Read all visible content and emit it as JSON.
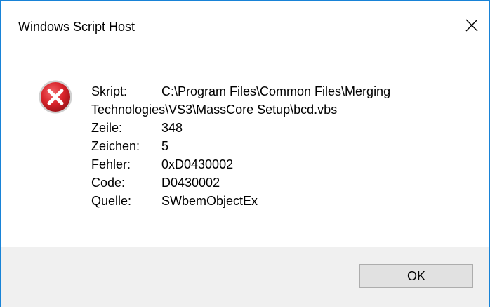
{
  "window": {
    "title": "Windows Script Host",
    "close_icon": "close-icon"
  },
  "message": {
    "icon": "error-icon",
    "script_label": "Skript:",
    "script_value_line1": "C:\\Program Files\\Common Files\\Merging",
    "script_value_line2": "Technologies\\VS3\\MassCore Setup\\bcd.vbs",
    "line_label": "Zeile:",
    "line_value": "348",
    "char_label": "Zeichen:",
    "char_value": "5",
    "error_label": "Fehler:",
    "error_value": "0xD0430002",
    "code_label": "Code:",
    "code_value": "D0430002",
    "source_label": "Quelle:",
    "source_value": "SWbemObjectEx"
  },
  "buttons": {
    "ok_label": "OK"
  },
  "colors": {
    "window_border": "#1883d7",
    "footer_bg": "#f0f0f0",
    "error_red": "#d8232a"
  }
}
